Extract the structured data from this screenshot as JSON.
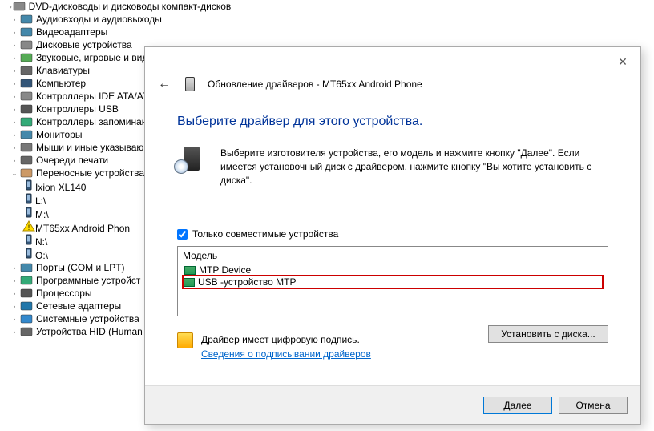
{
  "tree": {
    "items": [
      {
        "label": "DVD-дисководы и дисководы компакт-дисков",
        "icon": "dvd",
        "expander": ">"
      },
      {
        "label": "Аудиовходы и аудиовыходы",
        "icon": "audio",
        "expander": ">"
      },
      {
        "label": "Видеоадаптеры",
        "icon": "display",
        "expander": ">"
      },
      {
        "label": "Дисковые устройства",
        "icon": "disk",
        "expander": ">"
      },
      {
        "label": "Звуковые, игровые и вид",
        "icon": "sound",
        "expander": ">"
      },
      {
        "label": "Клавиатуры",
        "icon": "keyboard",
        "expander": ">"
      },
      {
        "label": "Компьютер",
        "icon": "computer",
        "expander": ">"
      },
      {
        "label": "Контроллеры IDE ATA/AT",
        "icon": "ide",
        "expander": ">"
      },
      {
        "label": "Контроллеры USB",
        "icon": "usb",
        "expander": ">"
      },
      {
        "label": "Контроллеры запоминан",
        "icon": "storage",
        "expander": ">"
      },
      {
        "label": "Мониторы",
        "icon": "monitor",
        "expander": ">"
      },
      {
        "label": "Мыши и иные указываю",
        "icon": "mouse",
        "expander": ">"
      },
      {
        "label": "Очереди печати",
        "icon": "printer",
        "expander": ">"
      },
      {
        "label": "Переносные устройства",
        "icon": "portable",
        "expander": "v",
        "expanded": true
      }
    ],
    "portable_children": [
      {
        "label": "Ixion XL140",
        "icon": "phone"
      },
      {
        "label": "L:\\",
        "icon": "phone"
      },
      {
        "label": "M:\\",
        "icon": "phone"
      },
      {
        "label": "MT65xx Android Phon",
        "icon": "warn"
      },
      {
        "label": "N:\\",
        "icon": "phone"
      },
      {
        "label": "O:\\",
        "icon": "phone"
      }
    ],
    "after": [
      {
        "label": "Порты (COM и LPT)",
        "icon": "port",
        "expander": ">"
      },
      {
        "label": "Программные устройст",
        "icon": "soft",
        "expander": ">"
      },
      {
        "label": "Процессоры",
        "icon": "cpu",
        "expander": ">"
      },
      {
        "label": "Сетевые адаптеры",
        "icon": "net",
        "expander": ">"
      },
      {
        "label": "Системные устройства",
        "icon": "sys",
        "expander": ">"
      },
      {
        "label": "Устройства HID (Human",
        "icon": "hid",
        "expander": ">"
      }
    ]
  },
  "dialog": {
    "title": "Обновление драйверов - MT65xx Android Phone",
    "heading": "Выберите драйвер для этого устройства.",
    "desc": "Выберите изготовителя устройства, его модель и нажмите кнопку \"Далее\". Если имеется установочный диск с  драйвером, нажмите кнопку \"Вы хотите установить с диска\".",
    "compat_checkbox": "Только совместимые устройства",
    "compat_checked": true,
    "model_header": "Модель",
    "model_options": [
      {
        "label": "MTP Device",
        "selected": false
      },
      {
        "label": "USB -устройство MTP",
        "selected": true
      }
    ],
    "sig_text": "Драйвер имеет цифровую подпись.",
    "sig_link": "Сведения о подписывании драйверов",
    "install_btn": "Установить с диска...",
    "next_btn": "Далее",
    "cancel_btn": "Отмена"
  }
}
